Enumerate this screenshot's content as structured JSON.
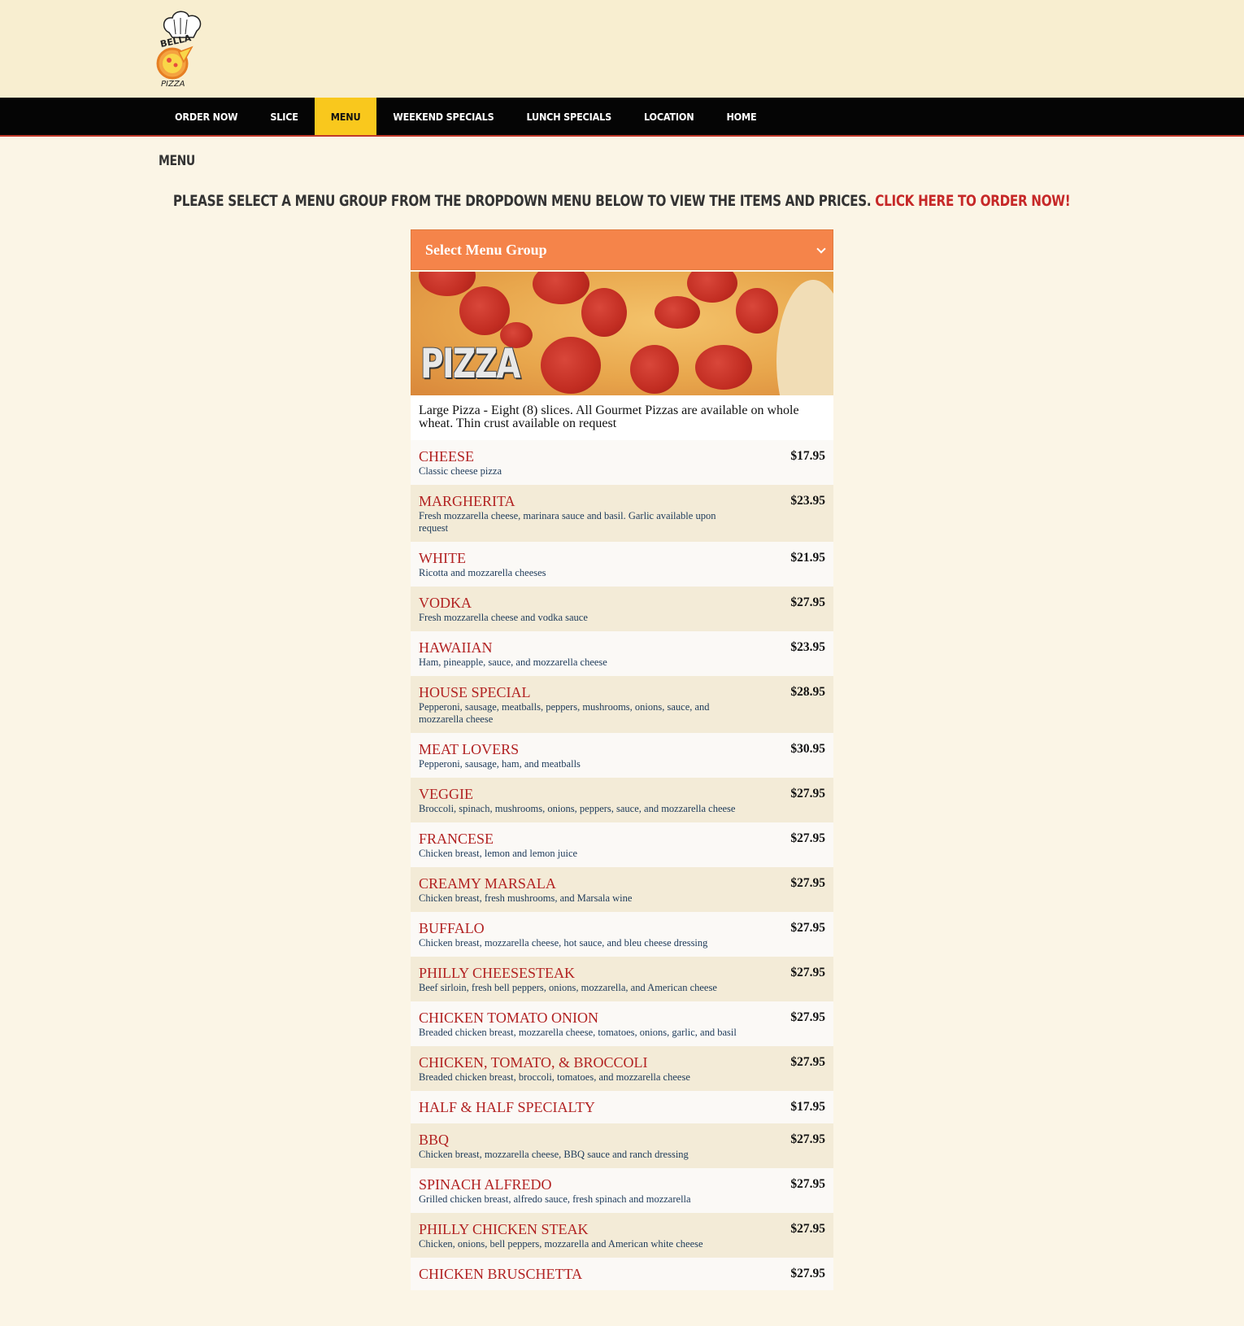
{
  "logo": {
    "alt": "Bella Pizza",
    "text_top": "BELLA",
    "text_bottom": "PIZZA"
  },
  "nav": {
    "items": [
      {
        "label": "ORDER NOW"
      },
      {
        "label": "SLICE"
      },
      {
        "label": "MENU",
        "active": true
      },
      {
        "label": "WEEKEND SPECIALS"
      },
      {
        "label": "LUNCH SPECIALS"
      },
      {
        "label": "LOCATION"
      },
      {
        "label": "HOME"
      }
    ]
  },
  "page": {
    "title": "MENU",
    "intro_text": "PLEASE SELECT A MENU GROUP FROM THE DROPDOWN MENU BELOW TO VIEW THE ITEMS AND PRICES.",
    "order_link": "CLICK HERE TO ORDER NOW!"
  },
  "menu_select": {
    "value": "Select Menu Group"
  },
  "group": {
    "banner_title": "PIZZA",
    "description": "Large Pizza - Eight (8) slices. All Gourmet Pizzas are available on whole wheat. Thin crust available on request"
  },
  "items": [
    {
      "name": "CHEESE",
      "desc": "Classic cheese pizza",
      "price": "$17.95"
    },
    {
      "name": "MARGHERITA",
      "desc": "Fresh mozzarella cheese, marinara sauce and basil. Garlic available upon request",
      "price": "$23.95"
    },
    {
      "name": "WHITE",
      "desc": "Ricotta and mozzarella cheeses",
      "price": "$21.95"
    },
    {
      "name": "VODKA",
      "desc": "Fresh mozzarella cheese and vodka sauce",
      "price": "$27.95"
    },
    {
      "name": "HAWAIIAN",
      "desc": "Ham, pineapple, sauce, and mozzarella cheese",
      "price": "$23.95"
    },
    {
      "name": "HOUSE SPECIAL",
      "desc": "Pepperoni, sausage, meatballs, peppers, mushrooms, onions, sauce, and mozzarella cheese",
      "price": "$28.95"
    },
    {
      "name": "MEAT LOVERS",
      "desc": "Pepperoni, sausage, ham, and meatballs",
      "price": "$30.95"
    },
    {
      "name": "VEGGIE",
      "desc": "Broccoli, spinach, mushrooms, onions, peppers, sauce, and mozzarella cheese",
      "price": "$27.95"
    },
    {
      "name": "FRANCESE",
      "desc": "Chicken breast, lemon and lemon juice",
      "price": "$27.95"
    },
    {
      "name": "CREAMY MARSALA",
      "desc": "Chicken breast, fresh mushrooms, and Marsala wine",
      "price": "$27.95"
    },
    {
      "name": "BUFFALO",
      "desc": "Chicken breast, mozzarella cheese, hot sauce, and bleu cheese dressing",
      "price": "$27.95"
    },
    {
      "name": "PHILLY CHEESESTEAK",
      "desc": "Beef sirloin, fresh bell peppers, onions, mozzarella, and American cheese",
      "price": "$27.95"
    },
    {
      "name": "CHICKEN TOMATO ONION",
      "desc": "Breaded chicken breast, mozzarella cheese, tomatoes, onions, garlic, and basil",
      "price": "$27.95"
    },
    {
      "name": "CHICKEN, TOMATO, & BROCCOLI",
      "desc": "Breaded chicken breast, broccoli, tomatoes, and mozzarella cheese",
      "price": "$27.95"
    },
    {
      "name": "HALF & HALF SPECIALTY",
      "desc": "",
      "price": "$17.95"
    },
    {
      "name": "BBQ",
      "desc": "Chicken breast, mozzarella cheese, BBQ sauce and ranch dressing",
      "price": "$27.95"
    },
    {
      "name": "SPINACH ALFREDO",
      "desc": "Grilled chicken breast, alfredo sauce, fresh spinach and mozzarella",
      "price": "$27.95"
    },
    {
      "name": "PHILLY CHICKEN STEAK",
      "desc": "Chicken, onions, bell peppers, mozzarella and American white cheese",
      "price": "$27.95"
    },
    {
      "name": "CHICKEN BRUSCHETTA",
      "desc": "",
      "price": "$27.95"
    }
  ]
}
